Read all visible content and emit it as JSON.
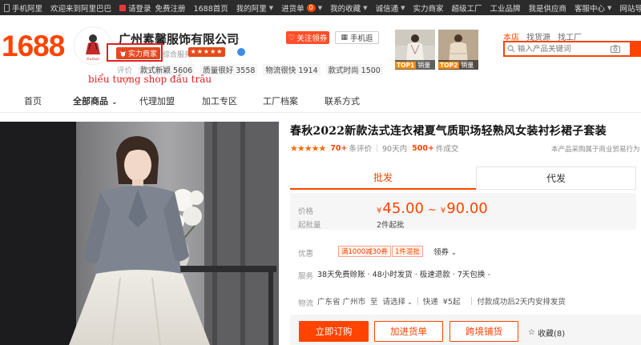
{
  "topbar": {
    "items": [
      "手机阿里",
      "欢迎来到阿里巴巴",
      "请登录",
      "免费注册",
      "1688首页",
      "我的阿里",
      "进货单",
      "我的收藏",
      "诚信通",
      "实力商家",
      "超级工厂",
      "工业品牌",
      "我是供应商",
      "客服中心",
      "网站导航"
    ],
    "cart_count": "0"
  },
  "header": {
    "logo": "1688",
    "shop_name": "广州素馨服饰有限公司",
    "power_merchant": "实力商家",
    "service_label": "综合服务",
    "follow_label": "关注领券",
    "mobile_label": "手机逛",
    "stats_label": "评价",
    "stats": [
      "款式新颖 5606",
      "质量很好 3558",
      "物流很快 1914",
      "款式时尚 1500"
    ],
    "annotation": "biểu tượng shop đầu trâu",
    "top1": {
      "rank": "TOP1",
      "label": "销量"
    },
    "top2": {
      "rank": "TOP2",
      "label": "销量"
    },
    "search_tabs": [
      "本店",
      "找货源",
      "找工厂"
    ],
    "search_placeholder": "输入产品关键词"
  },
  "nav": {
    "items": [
      "首页",
      "全部商品",
      "代理加盟",
      "加工专区",
      "工厂档案",
      "联系方式"
    ]
  },
  "product": {
    "title": "春秋2022新款法式连衣裙夏气质职场轻熟风女装衬衫裙子套装",
    "stars": "★★★★★",
    "rating_count": "70+",
    "rating_label": "条评价",
    "sold_label": "90天内",
    "sold_count": "500+",
    "sold_suffix": "件成交",
    "guarantee": "本产品采购属于商业贸易行为",
    "tab_wholesale": "批发",
    "tab_dropship": "代发",
    "price_label": "价格",
    "currency": "¥",
    "price_min": "45.00",
    "tilde": "~",
    "price_max": "90.00",
    "moq_label": "起批量",
    "moq": "2件起批",
    "promo_label": "优惠",
    "promo1": "满1000减30券",
    "promo2": "1件混批",
    "claim": "领券",
    "service_label": "服务",
    "services": "38天免费赊账 · 48小时发货 · 极速退款 · 7天包换",
    "logistics_label": "物流",
    "origin": "广东省 广州市",
    "to": "至",
    "dest": "请选择",
    "express": "快递",
    "express_fee": "¥5起",
    "ship_time": "付款成功后2天内安排发货",
    "buy_now": "立即订购",
    "add_cart": "加进货单",
    "cross_border": "跨境铺货",
    "fav_label": "收藏(8)"
  },
  "colors": {
    "accent": "#ff4400",
    "annotation_red": "#e02020",
    "topbar_bg": "#2b2b2b"
  }
}
